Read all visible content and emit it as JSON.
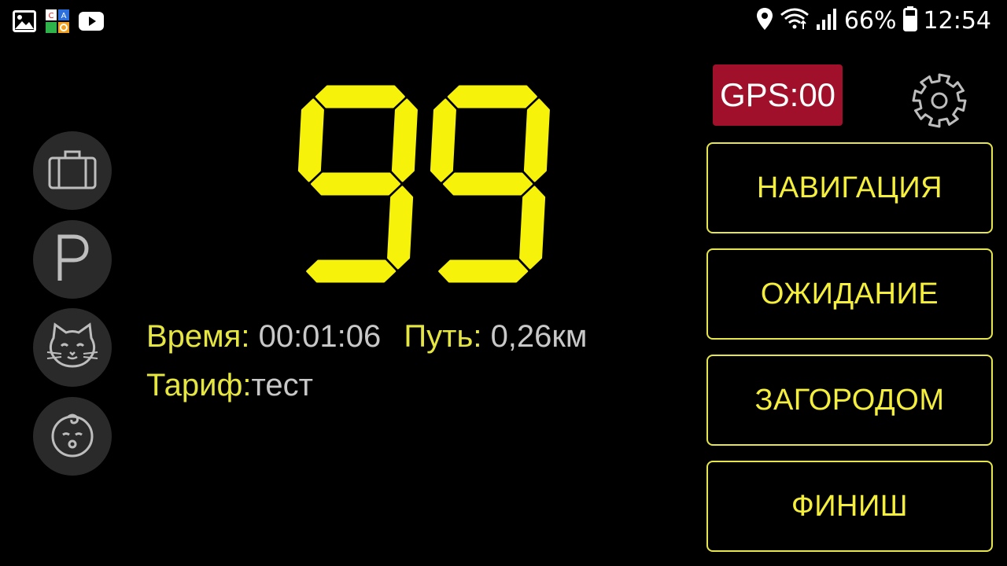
{
  "status_bar": {
    "left_icons": [
      "gallery-icon",
      "app-logo-icon",
      "youtube-icon"
    ],
    "right_icons": [
      "location-icon",
      "wifi-icon",
      "signal-icon",
      "battery-icon"
    ],
    "battery_percent": "66%",
    "time": "12:54"
  },
  "side_buttons": [
    {
      "icon": "suitcase-icon"
    },
    {
      "icon": "parking-icon"
    },
    {
      "icon": "cat-icon"
    },
    {
      "icon": "baby-icon"
    }
  ],
  "meter": {
    "value": "99",
    "color": "#f7f20a"
  },
  "info": {
    "time_label": "Время:",
    "time_value": "00:01:06",
    "distance_label": "Путь:",
    "distance_value": "0,26км",
    "tariff_label": "Тариф:",
    "tariff_value": "тест"
  },
  "gps": {
    "label": "GPS:00",
    "color": "#a0102a"
  },
  "actions": [
    {
      "label": "НАВИГАЦИЯ"
    },
    {
      "label": "ОЖИДАНИЕ"
    },
    {
      "label": "ЗАГОРОДОМ"
    },
    {
      "label": "ФИНИШ"
    }
  ],
  "colors": {
    "accent": "#f4ee3c",
    "label": "#e6e641",
    "value": "#c8c8c8",
    "button_bg": "#2a2a2a"
  }
}
